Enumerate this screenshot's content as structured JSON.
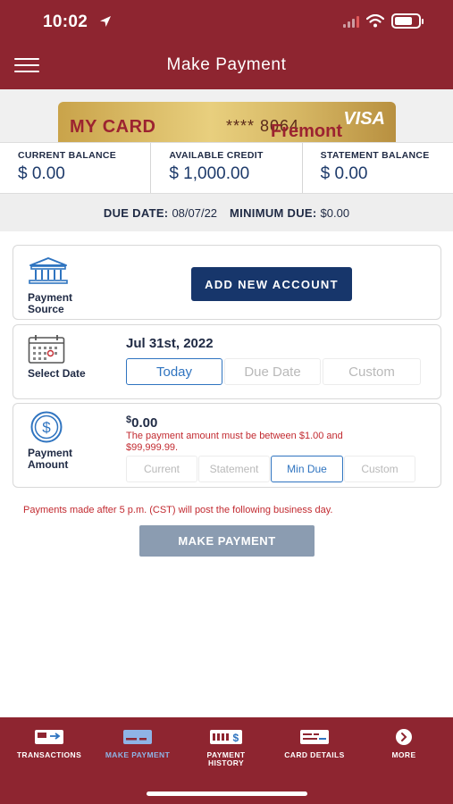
{
  "status": {
    "time": "10:02"
  },
  "header": {
    "title": "Make Payment"
  },
  "card": {
    "name": "MY CARD",
    "number_masked": "**** 8064",
    "network": "VISA",
    "bank": "Fremont"
  },
  "balances": [
    {
      "label": "CURRENT BALANCE",
      "value": "$ 0.00"
    },
    {
      "label": "AVAILABLE CREDIT",
      "value": "$ 1,000.00"
    },
    {
      "label": "STATEMENT BALANCE",
      "value": "$ 0.00"
    }
  ],
  "due": {
    "due_label": "DUE DATE:",
    "due_value": "08/07/22",
    "min_label": "MINIMUM DUE:",
    "min_value": "$0.00"
  },
  "payment_source": {
    "label_line1": "Payment",
    "label_line2": "Source",
    "add_button": "ADD NEW ACCOUNT"
  },
  "select_date": {
    "label": "Select Date",
    "date": "Jul 31st, 2022",
    "options": [
      "Today",
      "Due Date",
      "Custom"
    ],
    "selected": "Today"
  },
  "payment_amount": {
    "label_line1": "Payment",
    "label_line2": "Amount",
    "currency": "$",
    "amount": "0.00",
    "error": "The payment amount must be between $1.00 and $99,999.99.",
    "options": [
      "Current",
      "Statement",
      "Min Due",
      "Custom"
    ],
    "selected": "Min Due"
  },
  "notice": "Payments made after 5 p.m. (CST) will post the following business day.",
  "make_payment_button": "MAKE PAYMENT",
  "bottom_nav": [
    {
      "label": "TRANSACTIONS",
      "icon": "transactions-icon"
    },
    {
      "label": "MAKE PAYMENT",
      "icon": "make-payment-icon",
      "active": true
    },
    {
      "label_line1": "PAYMENT",
      "label_line2": "HISTORY",
      "icon": "payment-history-icon"
    },
    {
      "label": "CARD DETAILS",
      "icon": "card-details-icon"
    },
    {
      "label": "MORE",
      "icon": "more-icon"
    }
  ],
  "colors": {
    "brand": "#8e2530",
    "primary_button": "#17366b",
    "accent": "#2f74c0",
    "error": "#c22a30",
    "disabled_button": "#8b9cb1",
    "nav_active": "#8fb4e6"
  }
}
